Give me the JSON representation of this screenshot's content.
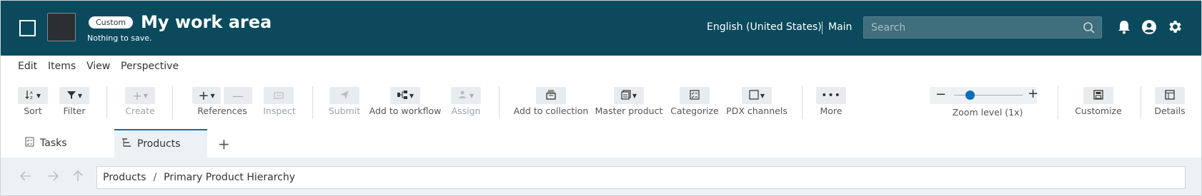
{
  "header": {
    "badge": "Custom",
    "title": "My work area",
    "save_status": "Nothing to save.",
    "locale": "English (United States)",
    "channel": "Main",
    "search_placeholder": "Search",
    "background_color": "#0a4a5c"
  },
  "menu": {
    "items": [
      "Edit",
      "Items",
      "View",
      "Perspective"
    ]
  },
  "toolbar": {
    "sort": "Sort",
    "filter": "Filter",
    "create": "Create",
    "references": "References",
    "inspect": "Inspect",
    "submit": "Submit",
    "add_to_workflow": "Add to workflow",
    "assign": "Assign",
    "add_to_collection": "Add to collection",
    "master_product": "Master product",
    "categorize": "Categorize",
    "pdx_channels": "PDX channels",
    "more": "More",
    "zoom_level": "Zoom level (1x)",
    "customize": "Customize",
    "details": "Details"
  },
  "tabs": [
    {
      "label": "Tasks",
      "icon": "tasks-icon"
    },
    {
      "label": "Products",
      "icon": "hierarchy-icon"
    }
  ],
  "breadcrumb": {
    "root": "Products",
    "separator": "/",
    "current": "Primary Product Hierarchy"
  },
  "colors": {
    "accent": "#0a6fb5",
    "header": "#0a4a5c",
    "disabled": "#9aa3a8"
  }
}
